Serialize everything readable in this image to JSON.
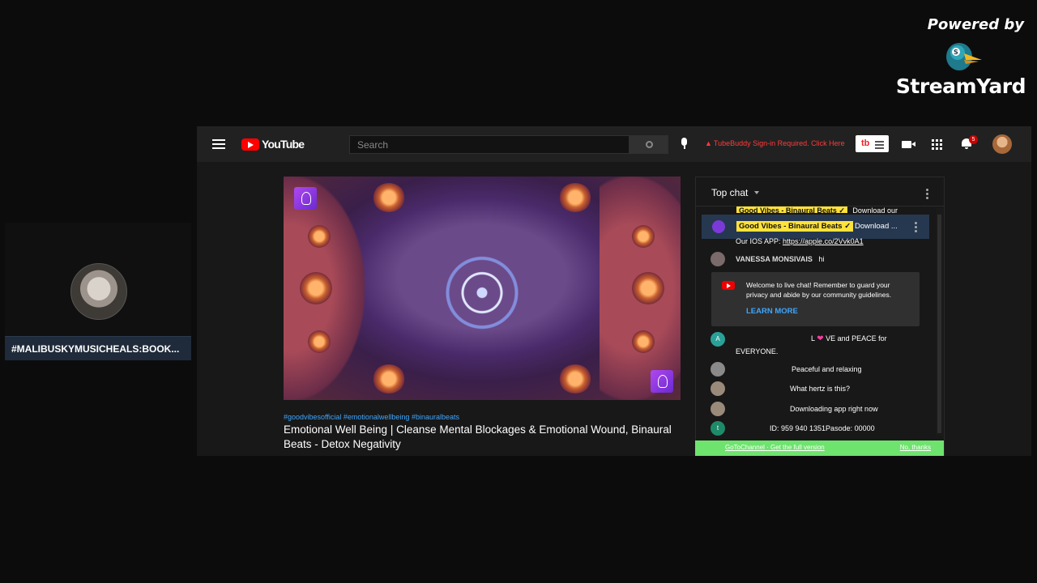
{
  "branding": {
    "powered_by": "Powered by",
    "name": "StreamYard"
  },
  "guest": {
    "display_name": "#MALIBUSKYMUSICHEALS:BOOK..."
  },
  "youtube": {
    "logo_text": "YouTube",
    "search_placeholder": "Search",
    "tubebuddy_warning": "TubeBuddy Sign-in Required. Click Here",
    "tubebuddy_badge": "tb",
    "notification_count": "5",
    "video": {
      "tags": "#goodvibesofficial #emotionalwellbeing #binauralbeats",
      "title": "Emotional Well Being | Cleanse Mental Blockages & Emotional Wound, Binaural Beats - Detox Negativity"
    },
    "chat": {
      "header": "Top chat",
      "pinned_ghost_name": "Good Vibes - Binaural Beats ✓",
      "pinned_ghost_msg": "Download our",
      "pinned_name": "Good Vibes - Binaural Beats ✓",
      "pinned_msg": "Download ...",
      "ios_prefix": "Our IOS APP: ",
      "ios_link": "https://apple.co/2Vvk0A1",
      "messages": [
        {
          "author": "VANESSA MONSIVAIS",
          "text": "hi",
          "avatar_color": "#7a6a6a"
        },
        {
          "author": "",
          "text_a": "L",
          "text_b": "VE and PEACE for",
          "text_c": "EVERYONE.",
          "avatar_letter": "A",
          "avatar_color": "#2aa198"
        },
        {
          "author": "",
          "text": "Peaceful and relaxing",
          "avatar_color": "#8a8a8a"
        },
        {
          "author": "",
          "text": "What hertz is this?",
          "avatar_color": "#9a8a7a"
        },
        {
          "author": "",
          "text": "Downloading app right now",
          "avatar_color": "#9a8a7a"
        },
        {
          "author": "",
          "text": "ID: 959 940 1351Pasode: 00000",
          "avatar_letter": "t",
          "avatar_color": "#1f8a6a"
        }
      ],
      "welcome_text": "Welcome to live chat! Remember to guard your privacy and abide by our community guidelines.",
      "welcome_link": "LEARN MORE",
      "upsell_left": "GoToChannel · Get the full version",
      "upsell_right": "No, thanks"
    }
  },
  "colors": {
    "background": "#0c0c0c",
    "youtube_red": "#ff0000",
    "link_blue": "#3ea6ff",
    "highlight_yellow": "#ffe23a",
    "upsell_green": "#6ee36e"
  }
}
